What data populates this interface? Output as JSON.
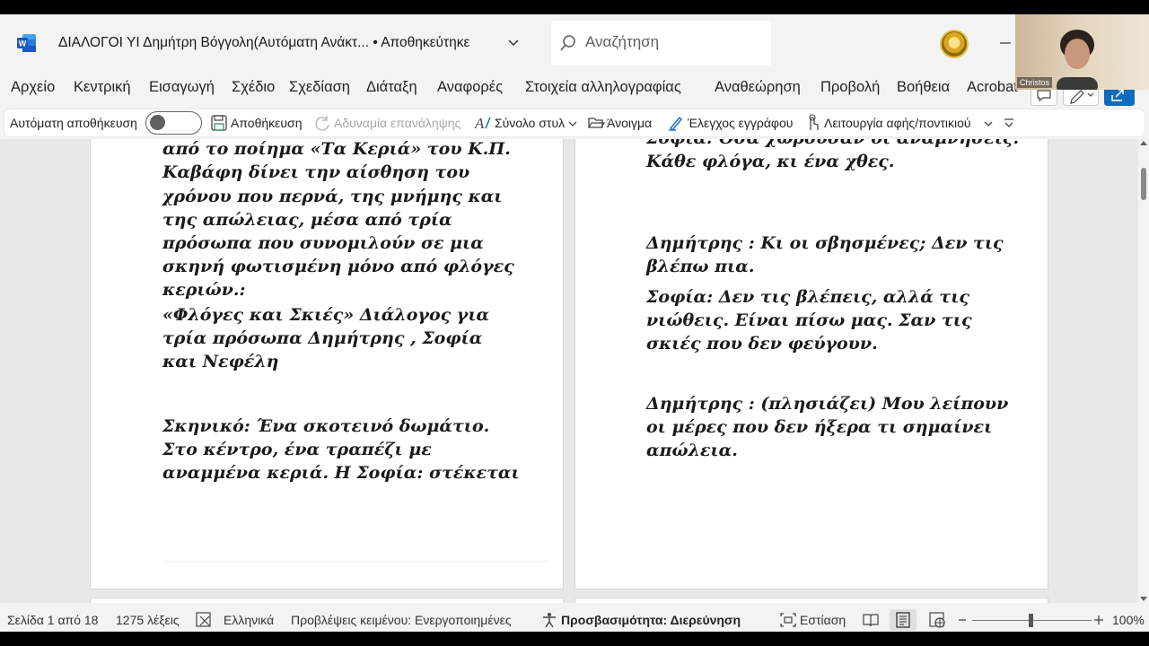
{
  "titlebar": {
    "doc_title": "ΔΙΑΛΟΓΟΙ  ΥΙ   Δημήτρη Βόγγολη(Αυτόματη Ανάκτ...  • Αποθηκεύτηκε",
    "search_placeholder": "Αναζήτηση"
  },
  "webcam": {
    "name": "Christos"
  },
  "ribbon": {
    "tabs": [
      "Αρχείο",
      "Κεντρική",
      "Εισαγωγή",
      "Σχέδιο",
      "Σχεδίαση",
      "Διάταξη",
      "Αναφορές",
      "Στοιχεία αλληλογραφίας",
      "Αναθεώρηση",
      "Προβολή",
      "Βοήθεια",
      "Acrobat"
    ]
  },
  "qat": {
    "autosave_label": "Αυτόματη αποθήκευση",
    "autosave_state": "off",
    "save_label": "Αποθήκευση",
    "redo_label": "Αδυναμία επανάληψης",
    "styles_label": "Σύνολο στυλ",
    "open_label": "Άνοιγμα",
    "check_label": "Έλεγχος εγγράφου",
    "touch_label": "Λειτουργία αφής/ποντικιού"
  },
  "page1": {
    "intro": "Ένα θεατρικό διάλογο εμπνευσμένο από το ποίημα «Τα Κεριά» του Κ.Π. Καβάφη δίνει την αίσθηση του χρόνου που περνά, της μνήμης και της απώλειας, μέσα από τρία πρόσωπα που συνομιλούν σε μια σκηνή φωτισμένη μόνο από φλόγες κεριών.:",
    "heading": " «Φλόγες και Σκιές» Διάλογος για τρία πρόσωπα  Δημήτρης , Σοφία και Νεφέλη",
    "scene": "Σκηνικό: Ένα σκοτεινό δωμάτιο. Στο κέντρο, ένα τραπέζι με αναμμένα κεριά. Η Σοφία: στέκεται"
  },
  "page2": {
    "b1": "Σοφία: Όσα χωρούσαν οι αναμνήσεις. Κάθε φλόγα, κι ένα χθες.",
    "b2": "Δημήτρης  : Κι οι σβησμένες; Δεν τις βλέπω πια.",
    "b3": "Σοφία: Δεν τις βλέπεις, αλλά τις νιώθεις. Είναι πίσω μας. Σαν τις σκιές που δεν φεύγουν.",
    "b4": "Δημήτρης  : (πλησιάζει) Μου λείπουν οι μέρες που δεν ήξερα τι σημαίνει απώλεια."
  },
  "status": {
    "page": "Σελίδα 1 από 18",
    "words": "1275 λέξεις",
    "language": "Ελληνικά",
    "predictions": "Προβλέψεις κειμένου: Ενεργοποιημένες",
    "accessibility": "Προσβασιμότητα: Διερεύνηση",
    "focus": "Εστίαση",
    "zoom": "100%",
    "zoom_level": 1.0
  },
  "colors": {
    "word_blue": "#185abd",
    "accent": "#0f6cbd"
  }
}
